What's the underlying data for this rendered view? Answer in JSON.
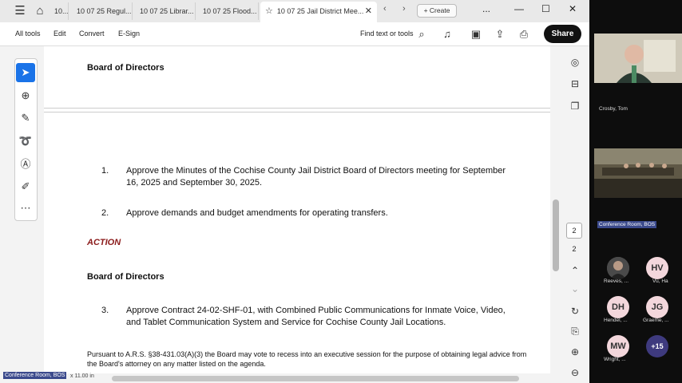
{
  "tabs": [
    {
      "label": "10..."
    },
    {
      "label": "10 07 25 Regul..."
    },
    {
      "label": "10 07 25 Librar..."
    },
    {
      "label": "10 07 25 Flood..."
    },
    {
      "label": "10 07 25 Jail District Mee..."
    }
  ],
  "toolbar": {
    "create_label": "Create",
    "more_label": "...",
    "share_label": "Share",
    "find_label": "Find text or tools"
  },
  "menu": [
    "All tools",
    "Edit",
    "Convert",
    "E-Sign"
  ],
  "document": {
    "heading_top": "Board of Directors",
    "item1_num": "1.",
    "item1_text": "Approve the Minutes of the Cochise County Jail District Board of Directors meeting for September 16, 2025 and September 30, 2025.",
    "item2_num": "2.",
    "item2_text": "Approve demands and budget amendments for operating transfers.",
    "action": "ACTION",
    "heading_mid": "Board of Directors",
    "item3_num": "3.",
    "item3_text": "Approve Contract 24-02-SHF-01, with Combined Public Communications for Inmate Voice, Video, and Tablet Communication System and Service for Cochise County Jail Locations.",
    "pursuant": "Pursuant to A.R.S. §38-431.03(A)(3) the Board may vote to recess into an executive session for the purpose of obtaining legal advice from the Board's attorney on any matter listed on the agenda."
  },
  "pager": {
    "current": "2",
    "total": "2"
  },
  "zoom": {
    "participant1": "Crosby, Tom",
    "room_tag": "Conference Room, BOS",
    "p_reeves": "Reeves, ...",
    "p_vu": "Vu, Ha",
    "p_hendel": "Hendel, ...",
    "p_graeme": "Graeme, ...",
    "p_wright": "Wright, ...",
    "hv": "HV",
    "dh": "DH",
    "jg": "JG",
    "mw": "MW",
    "more": "+15"
  },
  "footer": {
    "room_tag": "Conference Room, BOS",
    "size": "x 11.00 in"
  }
}
